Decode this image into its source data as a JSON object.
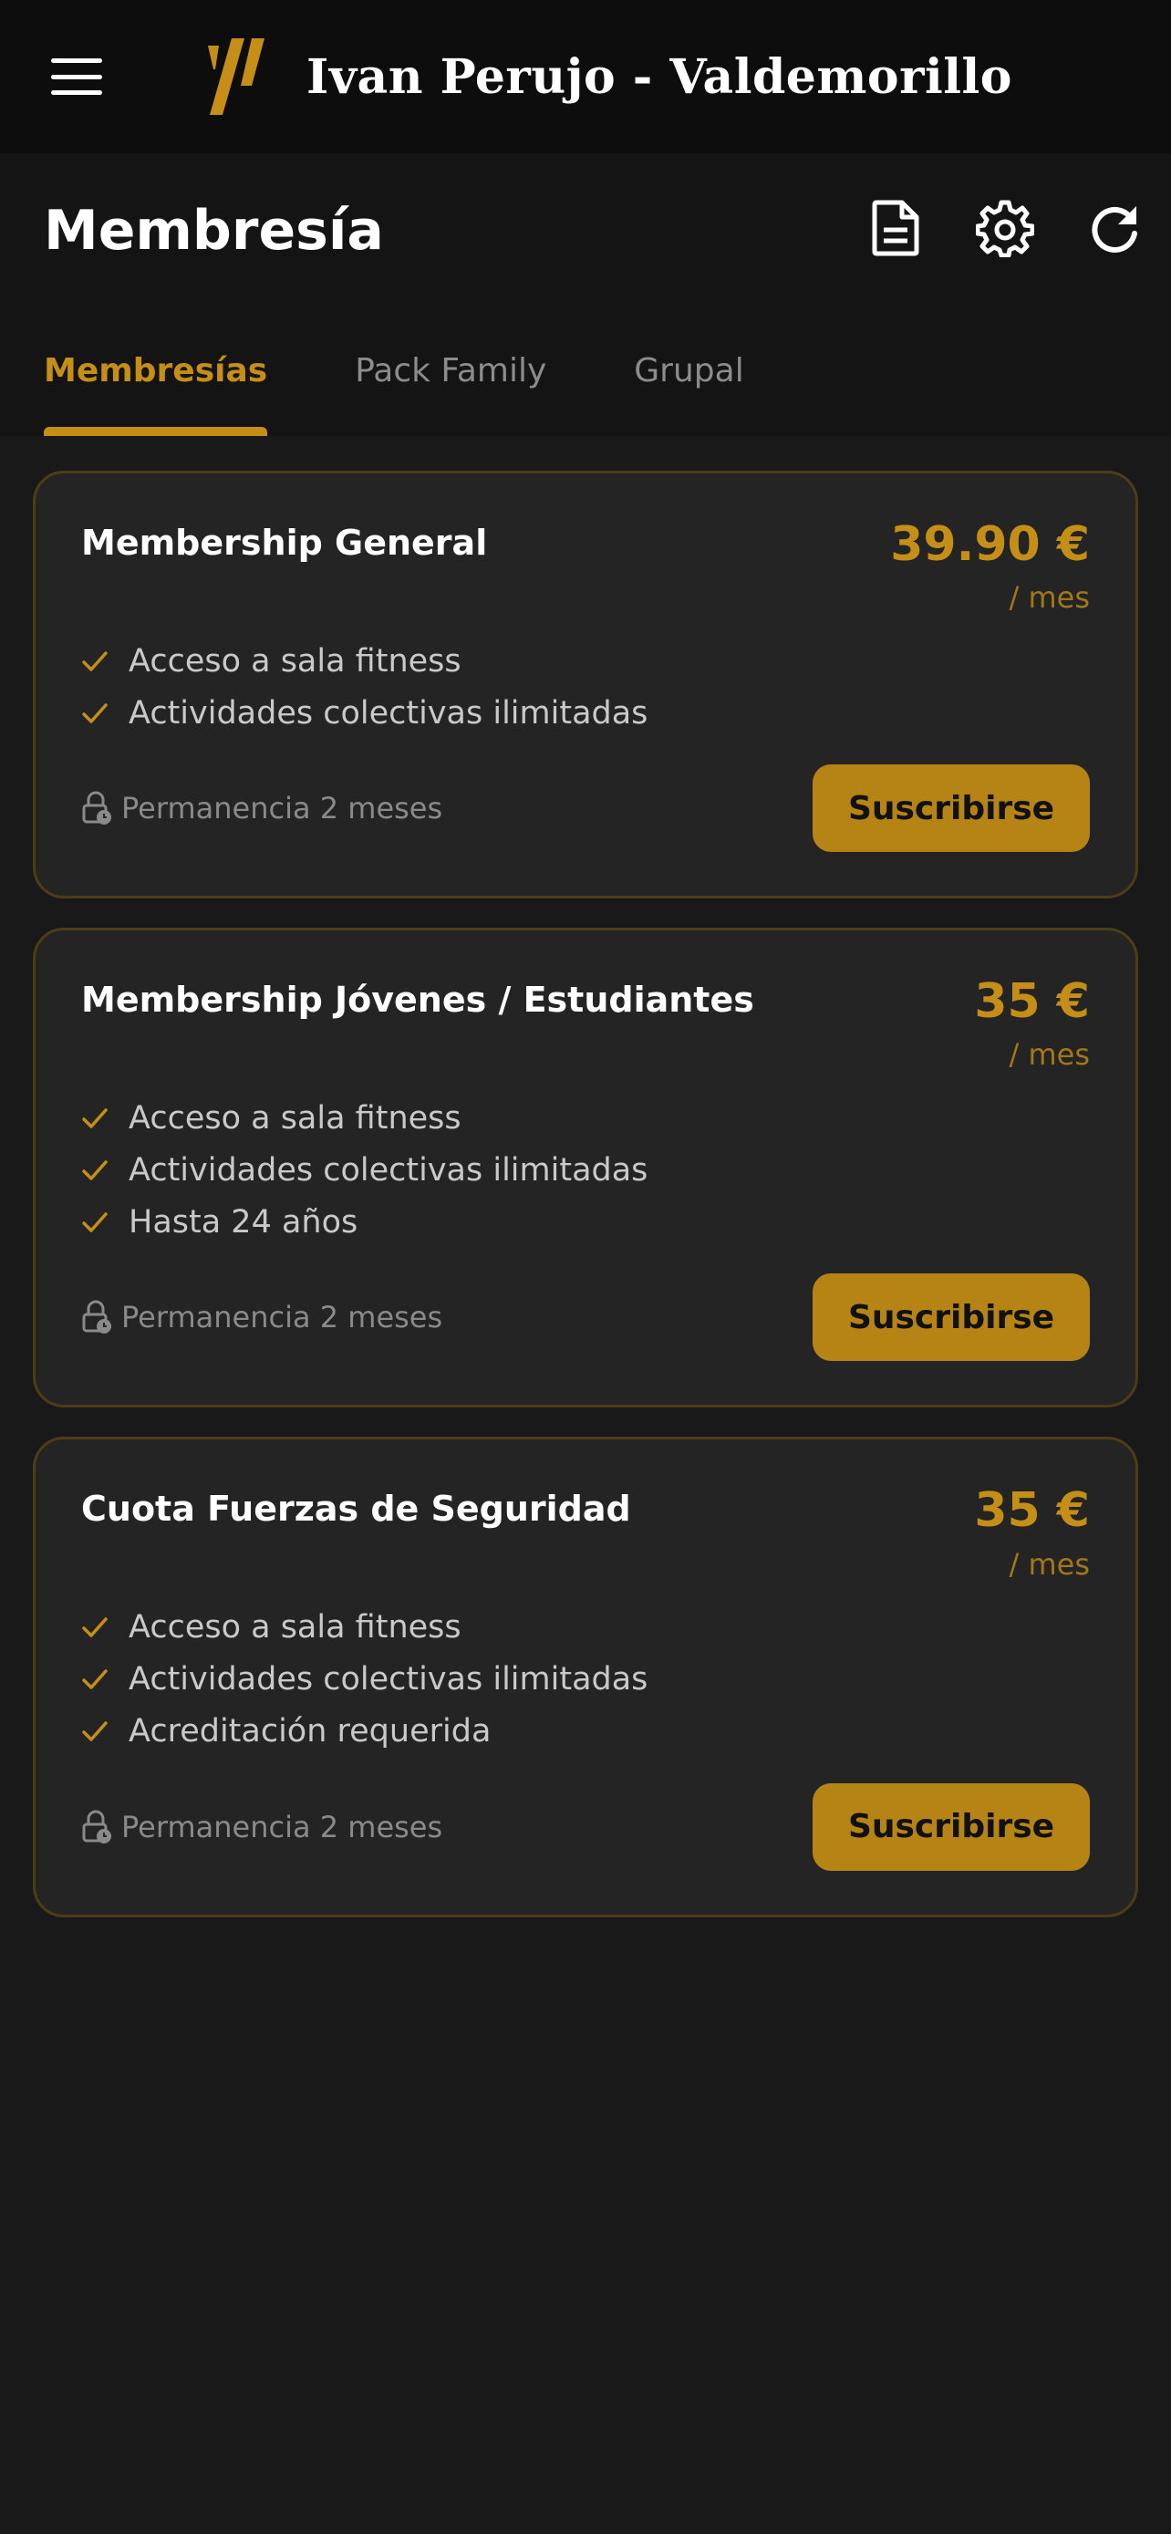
{
  "topbar": {
    "menu_icon": "hamburger-menu-icon",
    "logo_icon": "brand-logo-icon",
    "gym_name": "Ivan Perujo - Valdemorillo"
  },
  "header": {
    "title": "Membresía",
    "actions": [
      {
        "icon": "document-icon"
      },
      {
        "icon": "gear-icon"
      },
      {
        "icon": "refresh-icon"
      }
    ]
  },
  "tabs": [
    {
      "label": "Membresías",
      "active": true
    },
    {
      "label": "Pack Family",
      "active": false
    },
    {
      "label": "Grupal",
      "active": false
    }
  ],
  "colors": {
    "accent": "#c58f17",
    "button": "#b68415",
    "card_bg": "#242424",
    "card_border": "#4d3d16",
    "page_bg": "#191919"
  },
  "plans": [
    {
      "name": "Membership General",
      "price": "39.90 €",
      "period": "/ mes",
      "features": [
        "Acceso a sala fitness",
        "Actividades colectivas ilimitadas"
      ],
      "permanence": "Permanencia 2 meses",
      "button_label": "Suscribirse"
    },
    {
      "name": "Membership Jóvenes / Estudiantes",
      "price": "35 €",
      "period": "/ mes",
      "features": [
        "Acceso a sala fitness",
        "Actividades colectivas ilimitadas",
        "Hasta 24 años"
      ],
      "permanence": "Permanencia 2 meses",
      "button_label": "Suscribirse"
    },
    {
      "name": "Cuota Fuerzas de Seguridad",
      "price": "35 €",
      "period": "/ mes",
      "features": [
        "Acceso a sala fitness",
        "Actividades colectivas ilimitadas",
        "Acreditación requerida"
      ],
      "permanence": "Permanencia 2 meses",
      "button_label": "Suscribirse"
    }
  ]
}
